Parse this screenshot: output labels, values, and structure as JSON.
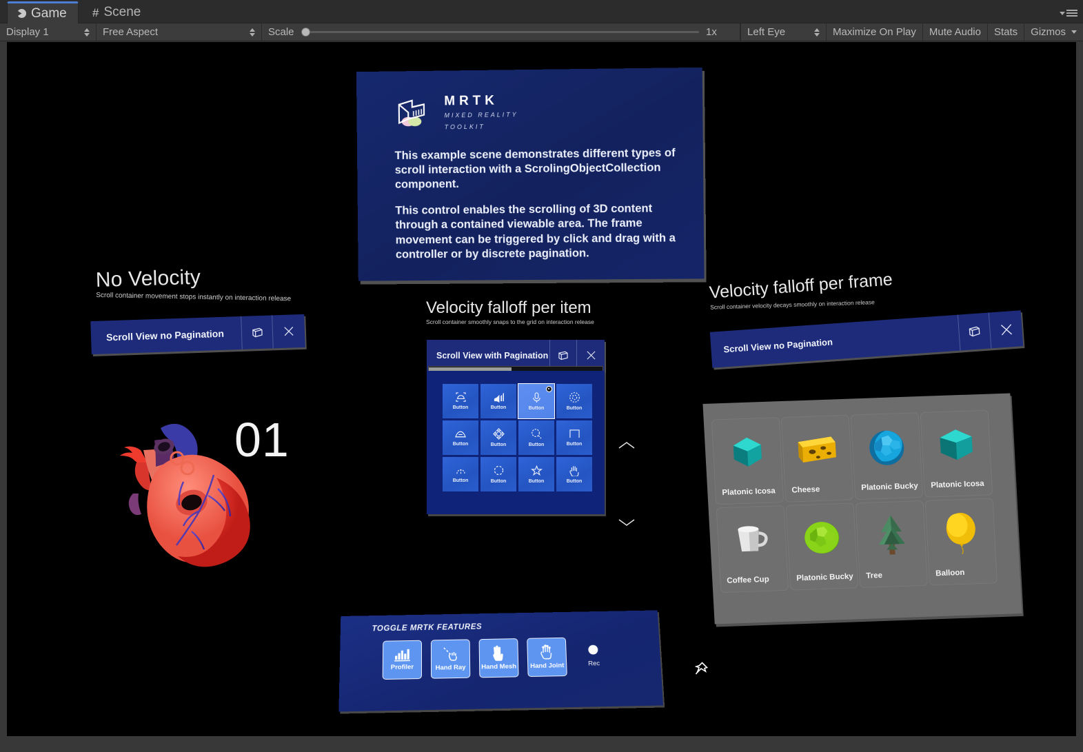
{
  "editor": {
    "tabs": [
      {
        "label": "Game",
        "icon": "unity-game-icon",
        "active": true
      },
      {
        "label": "Scene",
        "icon": "unity-scene-grid-icon",
        "active": false
      }
    ],
    "menu_icon": "panel-options-menu-icon",
    "toolbar": {
      "display": "Display 1",
      "aspect": "Free Aspect",
      "scale_label": "Scale",
      "scale_value": "1x",
      "eye": "Left Eye",
      "maximize_on_play": "Maximize On Play",
      "mute_audio": "Mute Audio",
      "stats": "Stats",
      "gizmos": "Gizmos"
    }
  },
  "scene": {
    "info_slate": {
      "logo_title": "MRTK",
      "logo_sub_line1": "MIXED REALITY",
      "logo_sub_line2": "TOOLKIT",
      "paragraphs": [
        "This example scene demonstrates different types of scroll interaction with a ScrolingObjectCollection component.",
        "This control enables the scrolling of 3D content through a contained viewable area. The frame movement can be triggered by click and drag with a controller or by discrete pagination."
      ]
    },
    "sections": [
      {
        "title": "No Velocity",
        "subtitle": "Scroll container movement stops instantly on interaction release",
        "header_title": "Scroll View no Pagination",
        "counter": "01"
      },
      {
        "title": "Velocity falloff per item",
        "subtitle": "Scroll container smoothly snaps to the grid on interaction release",
        "header_title": "Scroll View with Pagination"
      },
      {
        "title": "Velocity falloff per frame",
        "subtitle": "Scroll container velocity decays smoothly on interaction release",
        "header_title": "Scroll View no Pagination"
      }
    ],
    "header_icons": {
      "follow": "follow-me-icon",
      "close": "close-icon"
    },
    "button_grid": {
      "label": "Button",
      "selected_index": 2,
      "cells": [
        {
          "icon": "bounding-box-icon"
        },
        {
          "icon": "volume-up-icon"
        },
        {
          "icon": "microphone-icon"
        },
        {
          "icon": "hologram-settings-icon"
        },
        {
          "icon": "surface-magnetism-icon"
        },
        {
          "icon": "manipulation-icon"
        },
        {
          "icon": "search-icon"
        },
        {
          "icon": "slate-icon"
        },
        {
          "icon": "touch-icon"
        },
        {
          "icon": "rotate-icon"
        },
        {
          "icon": "star-icon"
        },
        {
          "icon": "hand-tracking-icon"
        }
      ]
    },
    "pager": {
      "up_icon": "chevron-up-icon",
      "down_icon": "chevron-down-icon"
    },
    "object_grid": [
      {
        "label": "Platonic Icosa",
        "art": "icosahedron-teal"
      },
      {
        "label": "Cheese",
        "art": "cheese-block"
      },
      {
        "label": "Platonic Bucky",
        "art": "buckyball-blue"
      },
      {
        "label": "Platonic Icosa",
        "art": "icosahedron-teal"
      },
      {
        "label": "Coffee Cup",
        "art": "coffee-mug-white"
      },
      {
        "label": "Platonic Bucky",
        "art": "buckyball-green"
      },
      {
        "label": "Tree",
        "art": "low-poly-tree"
      },
      {
        "label": "Balloon",
        "art": "balloon-yellow"
      }
    ],
    "toggle_panel": {
      "title": "TOGGLE MRTK FEATURES",
      "buttons": [
        {
          "label": "Profiler",
          "icon": "profiler-bars-icon",
          "active": true
        },
        {
          "label": "Hand Ray",
          "icon": "hand-ray-icon",
          "active": true
        },
        {
          "label": "Hand Mesh",
          "icon": "hand-mesh-icon",
          "active": true
        },
        {
          "label": "Hand Joint",
          "icon": "hand-joint-icon",
          "active": true
        }
      ],
      "rec_label": "Rec",
      "rec_icon": "record-dot-icon"
    },
    "cursor_icon": "pushpin-cursor-icon"
  },
  "colors": {
    "editor_chrome": "#3c3c3c",
    "tab_accent": "#4b7fd4",
    "slate_blue": "#16286e",
    "header_blue": "#1d2b7a",
    "grid_button_blue": "#2f64d8",
    "grid_button_selected": "#5f8ef0",
    "toggle_button_blue": "#5d95f1",
    "object_card_gray": "#6f6f6f"
  }
}
